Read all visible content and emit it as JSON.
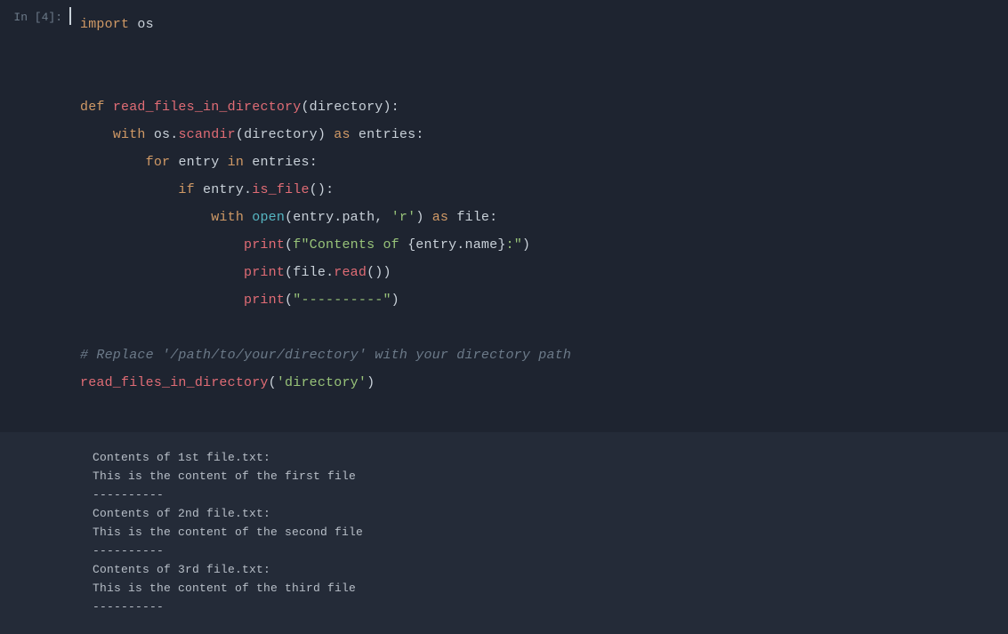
{
  "prompt": "In [4]:",
  "code": {
    "l1_import": "import",
    "l1_os": "os",
    "l3_def": "def",
    "l3_fname": "read_files_in_directory",
    "l3_param": "directory",
    "l4_with": "with",
    "l4_os": "os",
    "l4_scandir": "scandir",
    "l4_arg": "directory",
    "l4_as": "as",
    "l4_entries": "entries",
    "l5_for": "for",
    "l5_entry": "entry",
    "l5_in": "in",
    "l5_entries": "entries",
    "l6_if": "if",
    "l6_entry": "entry",
    "l6_isfile": "is_file",
    "l7_with": "with",
    "l7_open": "open",
    "l7_entry": "entry",
    "l7_path": "path",
    "l7_r": "'r'",
    "l7_as": "as",
    "l7_file": "file",
    "l8_print": "print",
    "l8_f": "f",
    "l8_str1": "\"Contents of ",
    "l8_expr_l": "{",
    "l8_entry": "entry",
    "l8_name": "name",
    "l8_expr_r": "}",
    "l8_str2": ":\"",
    "l9_print": "print",
    "l9_file": "file",
    "l9_read": "read",
    "l10_print": "print",
    "l10_str": "\"----------\"",
    "l12_comment": "# Replace '/path/to/your/directory' with your directory path",
    "l13_call": "read_files_in_directory",
    "l13_arg": "'directory'"
  },
  "output": {
    "l1": "Contents of 1st file.txt:",
    "l2": "This is the content of the first file",
    "l3": "----------",
    "l4": "Contents of 2nd file.txt:",
    "l5": "This is the content of the second file",
    "l6": "----------",
    "l7": "Contents of 3rd file.txt:",
    "l8": "This is the content of the third file",
    "l9": "----------"
  }
}
